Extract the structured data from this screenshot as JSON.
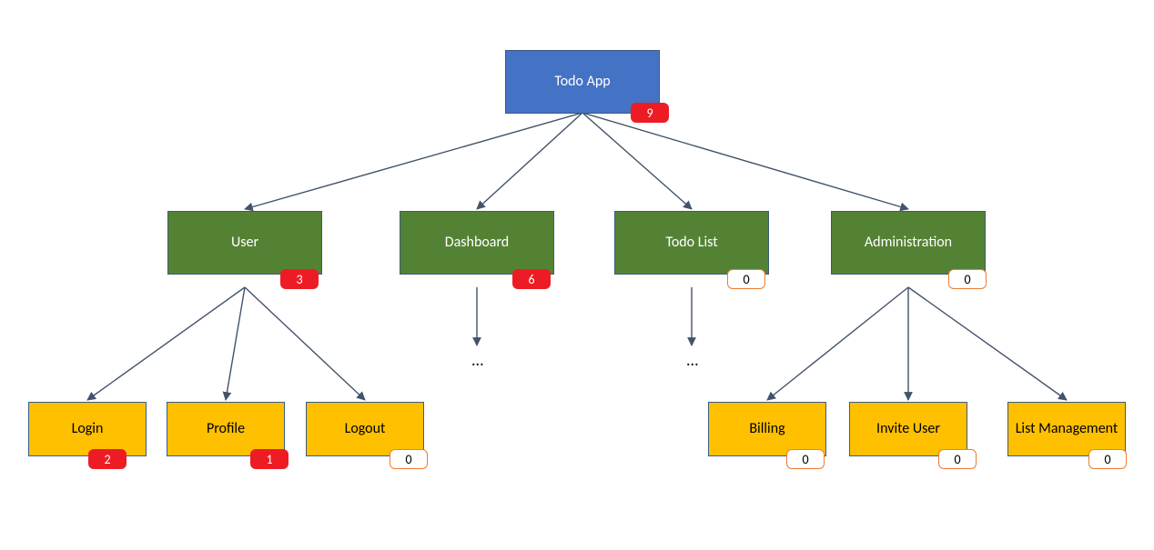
{
  "chart_data": {
    "type": "tree",
    "title": "",
    "nodes": [
      {
        "id": "root",
        "label": "Todo App",
        "level": 0,
        "badge": 9,
        "badge_style": "red",
        "parent": null
      },
      {
        "id": "user",
        "label": "User",
        "level": 1,
        "badge": 3,
        "badge_style": "red",
        "parent": "root"
      },
      {
        "id": "dash",
        "label": "Dashboard",
        "level": 1,
        "badge": 6,
        "badge_style": "red",
        "parent": "root"
      },
      {
        "id": "todo",
        "label": "Todo List",
        "level": 1,
        "badge": 0,
        "badge_style": "white",
        "parent": "root"
      },
      {
        "id": "admin",
        "label": "Administration",
        "level": 1,
        "badge": 0,
        "badge_style": "white",
        "parent": "root"
      },
      {
        "id": "login",
        "label": "Login",
        "level": 2,
        "badge": 2,
        "badge_style": "red",
        "parent": "user"
      },
      {
        "id": "prof",
        "label": "Profile",
        "level": 2,
        "badge": 1,
        "badge_style": "red",
        "parent": "user"
      },
      {
        "id": "logout",
        "label": "Logout",
        "level": 2,
        "badge": 0,
        "badge_style": "white",
        "parent": "user"
      },
      {
        "id": "dash_more",
        "label": "...",
        "level": 2,
        "badge": null,
        "badge_style": null,
        "parent": "dash"
      },
      {
        "id": "todo_more",
        "label": "...",
        "level": 2,
        "badge": null,
        "badge_style": null,
        "parent": "todo"
      },
      {
        "id": "bill",
        "label": "Billing",
        "level": 2,
        "badge": 0,
        "badge_style": "white",
        "parent": "admin"
      },
      {
        "id": "inv",
        "label": "Invite User",
        "level": 2,
        "badge": 0,
        "badge_style": "white",
        "parent": "admin"
      },
      {
        "id": "listm",
        "label": "List Management",
        "level": 2,
        "badge": 0,
        "badge_style": "white",
        "parent": "admin"
      }
    ],
    "colors": {
      "root": "#4472c4",
      "branch": "#548235",
      "leaf": "#ffc000",
      "badge_red": "#ed1c24",
      "badge_white_border": "#ed7d31"
    }
  },
  "root": {
    "label": "Todo App",
    "badge": "9"
  },
  "user": {
    "label": "User",
    "badge": "3"
  },
  "dash": {
    "label": "Dashboard",
    "badge": "6"
  },
  "todo": {
    "label": "Todo List",
    "badge": "0"
  },
  "admin": {
    "label": "Administration",
    "badge": "0"
  },
  "login": {
    "label": "Login",
    "badge": "2"
  },
  "prof": {
    "label": "Profile",
    "badge": "1"
  },
  "logout": {
    "label": "Logout",
    "badge": "0"
  },
  "bill": {
    "label": "Billing",
    "badge": "0"
  },
  "inv": {
    "label": "Invite User",
    "badge": "0"
  },
  "listm": {
    "label": "List Management",
    "badge": "0"
  },
  "ellipsis": "..."
}
